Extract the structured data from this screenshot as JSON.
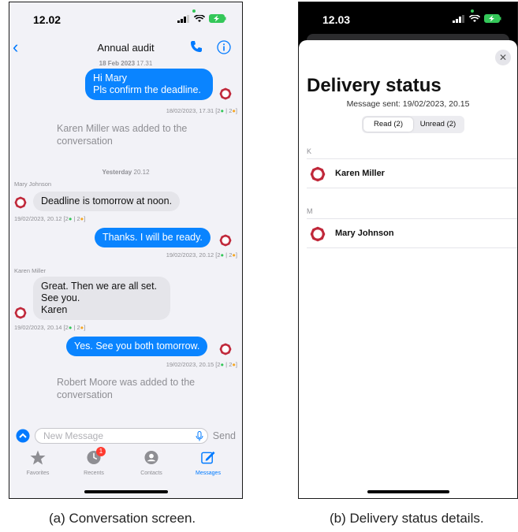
{
  "conversation": {
    "status_time": "12.02",
    "title": "Annual audit",
    "date_header_1": "18 Feb 2023",
    "date_header_1_time": "17.31",
    "msg1_line1": "Hi Mary",
    "msg1_line2": "Pls confirm the deadline.",
    "msg1_meta": "18/02/2023, 17.31",
    "sys1": "Karen Miller was added to the conversation",
    "date_header_2": "Yesterday",
    "date_header_2_time": "20.12",
    "msg2_sender": "Mary Johnson",
    "msg2_text": "Deadline is tomorrow at noon.",
    "msg2_meta": "19/02/2023, 20.12",
    "msg3_text": "Thanks. I will be ready.",
    "msg3_meta": "19/02/2023, 20.12",
    "msg4_sender": "Karen Miller",
    "msg4_line1": "Great. Then we are all set.",
    "msg4_line2": "See you.",
    "msg4_line3": "Karen",
    "msg4_meta": "19/02/2023, 20.14",
    "msg5_text": "Yes. See you both tomorrow.",
    "msg5_meta": "19/02/2023, 20.15",
    "sys2": "Robert Moore was added to the conversation",
    "receipt_prefix": "[2",
    "receipt_mid": "| 2",
    "receipt_suffix": "]",
    "compose_placeholder": "New Message",
    "send_label": "Send",
    "tabs": [
      {
        "label": "Favorites"
      },
      {
        "label": "Recents",
        "badge": "1"
      },
      {
        "label": "Contacts"
      },
      {
        "label": "Messages"
      }
    ],
    "caption": "(a) Conversation screen."
  },
  "delivery": {
    "status_time": "12.03",
    "title": "Delivery status",
    "subtitle": "Message sent: 19/02/2023, 20.15",
    "segments": [
      "Read (2)",
      "Unread (2)"
    ],
    "sections": [
      {
        "header": "K",
        "name": "Karen Miller"
      },
      {
        "header": "M",
        "name": "Mary Johnson"
      }
    ],
    "close_glyph": "✕",
    "caption": "(b) Delivery status details."
  },
  "colors": {
    "accent": "#007aff",
    "out_bubble": "#0a84ff",
    "in_bubble": "#e5e5ea",
    "logo": "#c0283a",
    "eye": "#34c759",
    "seen": "#f5a623",
    "badge": "#ff3b30"
  }
}
